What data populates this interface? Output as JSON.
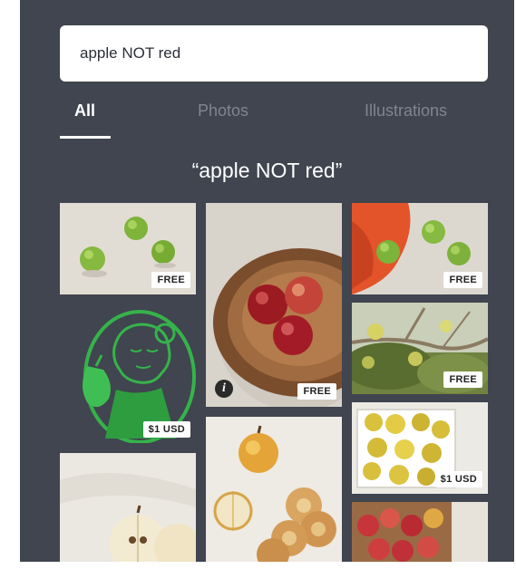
{
  "search": {
    "value": "apple NOT red"
  },
  "tabs": [
    {
      "label": "All",
      "active": true
    },
    {
      "label": "Photos",
      "active": false
    },
    {
      "label": "Illustrations",
      "active": false
    }
  ],
  "results_title": "“apple NOT red”",
  "tiles": [
    {
      "badge": "FREE"
    },
    {
      "badge": "FREE",
      "info": "i"
    },
    {
      "badge": "FREE"
    },
    {
      "badge": "$1 USD"
    },
    {
      "badge": "FREE"
    },
    {
      "badge": "$1 USD"
    },
    {
      "badge": ""
    },
    {
      "badge": ""
    },
    {
      "badge": ""
    }
  ],
  "colors": {
    "panel_bg": "#40454f",
    "active_tab": "#ffffff",
    "inactive_tab": "#7f8591"
  }
}
